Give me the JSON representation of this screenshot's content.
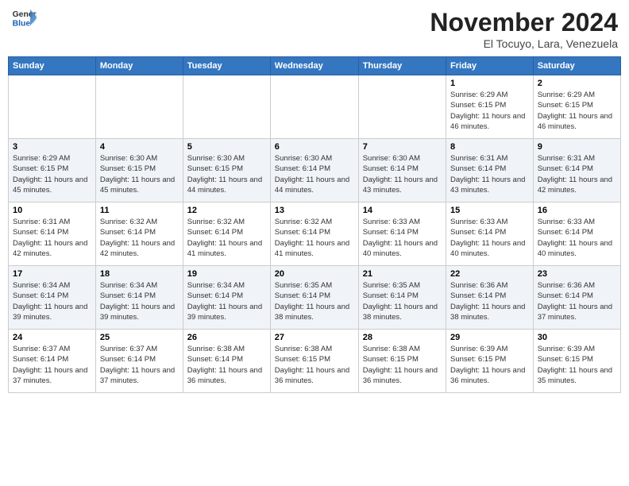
{
  "header": {
    "logo_line1": "General",
    "logo_line2": "Blue",
    "month": "November 2024",
    "location": "El Tocuyo, Lara, Venezuela"
  },
  "days_of_week": [
    "Sunday",
    "Monday",
    "Tuesday",
    "Wednesday",
    "Thursday",
    "Friday",
    "Saturday"
  ],
  "weeks": [
    [
      {
        "day": "",
        "info": ""
      },
      {
        "day": "",
        "info": ""
      },
      {
        "day": "",
        "info": ""
      },
      {
        "day": "",
        "info": ""
      },
      {
        "day": "",
        "info": ""
      },
      {
        "day": "1",
        "info": "Sunrise: 6:29 AM\nSunset: 6:15 PM\nDaylight: 11 hours and 46 minutes."
      },
      {
        "day": "2",
        "info": "Sunrise: 6:29 AM\nSunset: 6:15 PM\nDaylight: 11 hours and 46 minutes."
      }
    ],
    [
      {
        "day": "3",
        "info": "Sunrise: 6:29 AM\nSunset: 6:15 PM\nDaylight: 11 hours and 45 minutes."
      },
      {
        "day": "4",
        "info": "Sunrise: 6:30 AM\nSunset: 6:15 PM\nDaylight: 11 hours and 45 minutes."
      },
      {
        "day": "5",
        "info": "Sunrise: 6:30 AM\nSunset: 6:15 PM\nDaylight: 11 hours and 44 minutes."
      },
      {
        "day": "6",
        "info": "Sunrise: 6:30 AM\nSunset: 6:14 PM\nDaylight: 11 hours and 44 minutes."
      },
      {
        "day": "7",
        "info": "Sunrise: 6:30 AM\nSunset: 6:14 PM\nDaylight: 11 hours and 43 minutes."
      },
      {
        "day": "8",
        "info": "Sunrise: 6:31 AM\nSunset: 6:14 PM\nDaylight: 11 hours and 43 minutes."
      },
      {
        "day": "9",
        "info": "Sunrise: 6:31 AM\nSunset: 6:14 PM\nDaylight: 11 hours and 42 minutes."
      }
    ],
    [
      {
        "day": "10",
        "info": "Sunrise: 6:31 AM\nSunset: 6:14 PM\nDaylight: 11 hours and 42 minutes."
      },
      {
        "day": "11",
        "info": "Sunrise: 6:32 AM\nSunset: 6:14 PM\nDaylight: 11 hours and 42 minutes."
      },
      {
        "day": "12",
        "info": "Sunrise: 6:32 AM\nSunset: 6:14 PM\nDaylight: 11 hours and 41 minutes."
      },
      {
        "day": "13",
        "info": "Sunrise: 6:32 AM\nSunset: 6:14 PM\nDaylight: 11 hours and 41 minutes."
      },
      {
        "day": "14",
        "info": "Sunrise: 6:33 AM\nSunset: 6:14 PM\nDaylight: 11 hours and 40 minutes."
      },
      {
        "day": "15",
        "info": "Sunrise: 6:33 AM\nSunset: 6:14 PM\nDaylight: 11 hours and 40 minutes."
      },
      {
        "day": "16",
        "info": "Sunrise: 6:33 AM\nSunset: 6:14 PM\nDaylight: 11 hours and 40 minutes."
      }
    ],
    [
      {
        "day": "17",
        "info": "Sunrise: 6:34 AM\nSunset: 6:14 PM\nDaylight: 11 hours and 39 minutes."
      },
      {
        "day": "18",
        "info": "Sunrise: 6:34 AM\nSunset: 6:14 PM\nDaylight: 11 hours and 39 minutes."
      },
      {
        "day": "19",
        "info": "Sunrise: 6:34 AM\nSunset: 6:14 PM\nDaylight: 11 hours and 39 minutes."
      },
      {
        "day": "20",
        "info": "Sunrise: 6:35 AM\nSunset: 6:14 PM\nDaylight: 11 hours and 38 minutes."
      },
      {
        "day": "21",
        "info": "Sunrise: 6:35 AM\nSunset: 6:14 PM\nDaylight: 11 hours and 38 minutes."
      },
      {
        "day": "22",
        "info": "Sunrise: 6:36 AM\nSunset: 6:14 PM\nDaylight: 11 hours and 38 minutes."
      },
      {
        "day": "23",
        "info": "Sunrise: 6:36 AM\nSunset: 6:14 PM\nDaylight: 11 hours and 37 minutes."
      }
    ],
    [
      {
        "day": "24",
        "info": "Sunrise: 6:37 AM\nSunset: 6:14 PM\nDaylight: 11 hours and 37 minutes."
      },
      {
        "day": "25",
        "info": "Sunrise: 6:37 AM\nSunset: 6:14 PM\nDaylight: 11 hours and 37 minutes."
      },
      {
        "day": "26",
        "info": "Sunrise: 6:38 AM\nSunset: 6:14 PM\nDaylight: 11 hours and 36 minutes."
      },
      {
        "day": "27",
        "info": "Sunrise: 6:38 AM\nSunset: 6:15 PM\nDaylight: 11 hours and 36 minutes."
      },
      {
        "day": "28",
        "info": "Sunrise: 6:38 AM\nSunset: 6:15 PM\nDaylight: 11 hours and 36 minutes."
      },
      {
        "day": "29",
        "info": "Sunrise: 6:39 AM\nSunset: 6:15 PM\nDaylight: 11 hours and 36 minutes."
      },
      {
        "day": "30",
        "info": "Sunrise: 6:39 AM\nSunset: 6:15 PM\nDaylight: 11 hours and 35 minutes."
      }
    ]
  ]
}
